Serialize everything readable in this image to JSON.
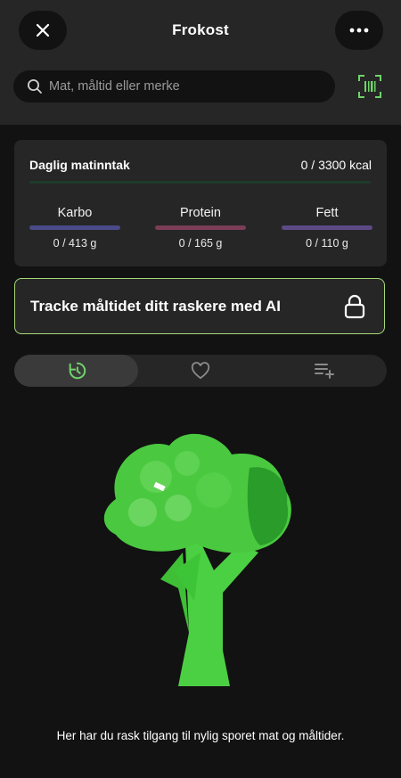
{
  "header": {
    "title": "Frokost",
    "close_icon": "close-icon",
    "more_icon": "more-horizontal-icon"
  },
  "search": {
    "placeholder": "Mat, måltid eller merke",
    "icon": "search-icon",
    "barcode_icon": "barcode-scan-icon"
  },
  "daily": {
    "title": "Daglig matinntak",
    "kcal": "0 / 3300 kcal",
    "progress": 0,
    "macros": [
      {
        "label": "Karbo",
        "value": "0 / 413 g",
        "color": "#4a4a8a",
        "progress": 0
      },
      {
        "label": "Protein",
        "value": "0 / 165 g",
        "color": "#7a3d55",
        "progress": 0
      },
      {
        "label": "Fett",
        "value": "0 / 110 g",
        "color": "#5c4a85",
        "progress": 0
      }
    ]
  },
  "ai_banner": {
    "text": "Tracke måltidet ditt raskere med AI",
    "icon": "lock-icon"
  },
  "tabs": [
    {
      "icon": "history-icon",
      "active": true
    },
    {
      "icon": "heart-icon",
      "active": false
    },
    {
      "icon": "playlist-add-icon",
      "active": false
    }
  ],
  "empty_state": {
    "illustration": "broccoli-illustration",
    "text": "Her har du rask tilgang til nylig sporet mat og måltider."
  },
  "colors": {
    "accent": "#6fd36a",
    "background": "#121212",
    "surface": "#262626",
    "banner_border": "#a7d977"
  }
}
